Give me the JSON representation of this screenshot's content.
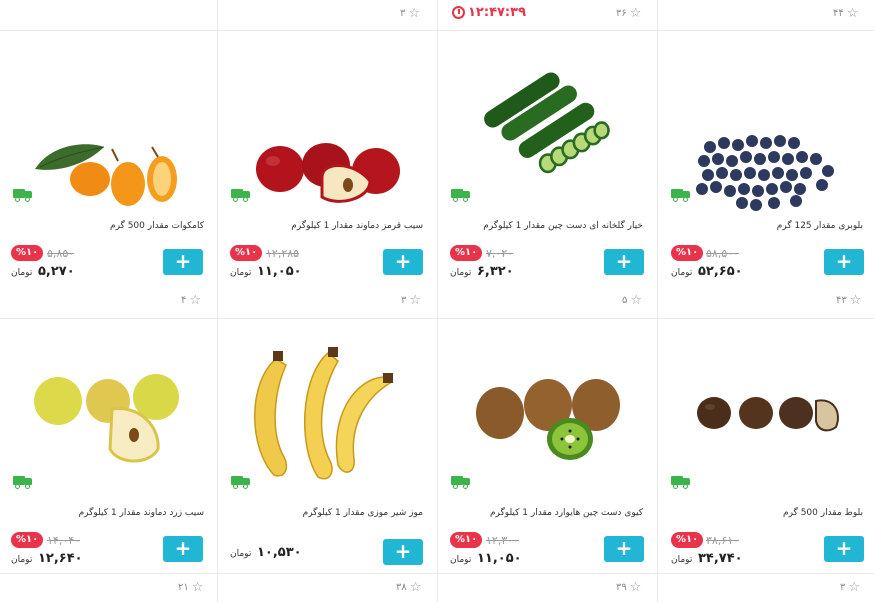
{
  "top_row": {
    "ratings": [
      "۳",
      "۳۶",
      "۴۴"
    ],
    "timer": "۱۲:۴۷:۳۹"
  },
  "currency": "تومان",
  "add_label": "+",
  "products": [
    {
      "title": "کامکوات مقدار 500 گرم",
      "discount": "%۱۰",
      "old_price": "۵,۸۵۰",
      "price": "۵,۲۷۰",
      "rating": "۴",
      "image": "kumquat"
    },
    {
      "title": "سیب قرمز دماوند مقدار 1 کیلوگرم",
      "discount": "%۱۰",
      "old_price": "۱۲,۲۸۵",
      "price": "۱۱,۰۵۰",
      "rating": "۳",
      "image": "red-apple"
    },
    {
      "title": "خیار گلخانه ای دست چین مقدار 1 کیلوگرم",
      "discount": "%۱۰",
      "old_price": "۷,۰۲۰",
      "price": "۶,۳۲۰",
      "rating": "۵",
      "image": "cucumber"
    },
    {
      "title": "بلوبری مقدار 125 گرم",
      "discount": "%۱۰",
      "old_price": "۵۸,۵۰۰",
      "price": "۵۲,۶۵۰",
      "rating": "۴۳",
      "image": "blueberry"
    },
    {
      "title": "سیب زرد دماوند مقدار 1 کیلوگرم",
      "discount": "%۱۰",
      "old_price": "۱۴,۰۴۰",
      "price": "۱۲,۶۴۰",
      "rating": "۲۱",
      "image": "yellow-apple"
    },
    {
      "title": "موز شیر موزی مقدار 1 کیلوگرم",
      "discount": "",
      "old_price": "",
      "price": "۱۰,۵۳۰",
      "rating": "۳۸",
      "image": "banana"
    },
    {
      "title": "کیوی دست چین هایوارد مقدار 1 کیلوگرم",
      "discount": "%۱۰",
      "old_price": "۱۲,۳۰۰",
      "price": "۱۱,۰۵۰",
      "rating": "۳۹",
      "image": "kiwi"
    },
    {
      "title": "بلوط مقدار 500 گرم",
      "discount": "%۱۰",
      "old_price": "۳۸,۶۱۰",
      "price": "۳۴,۷۴۰",
      "rating": "۳",
      "image": "acorn"
    }
  ]
}
